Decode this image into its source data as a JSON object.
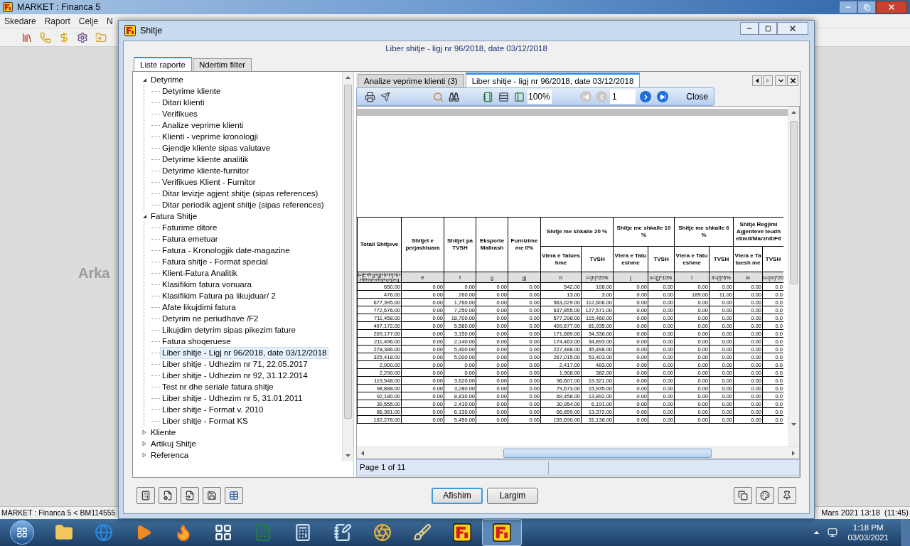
{
  "app_window": {
    "title": "MARKET : Financa 5",
    "menu": [
      "Skedare",
      "Raport",
      "Celje",
      "N"
    ],
    "background_text": "Arka",
    "status_left": "MARKET : Financa 5 < BM114555",
    "status_right": "Mars 2021 13:18  (11:45)"
  },
  "dialog": {
    "title": "Shitje",
    "subtitle": "Liber shitje - ligj nr 96/2018, date 03/12/2018",
    "tabs": [
      {
        "label": "Liste raporte",
        "selected": true
      },
      {
        "label": "Ndertim filter",
        "selected": false
      }
    ],
    "tree": [
      {
        "label": "Detyrime",
        "expanded": true,
        "selected": false,
        "children": [
          {
            "label": "Detyrime kliente",
            "selected": false
          },
          {
            "label": "Ditari klienti",
            "selected": false
          },
          {
            "label": "Verifikues",
            "selected": false
          },
          {
            "label": "Analize veprime klienti",
            "selected": false
          },
          {
            "label": "Klienti - veprime kronologji",
            "selected": false
          },
          {
            "label": "Gjendje kliente sipas valutave",
            "selected": false
          },
          {
            "label": "Detyrime kliente analitik",
            "selected": false
          },
          {
            "label": "Detyrime kliente-furnitor",
            "selected": false
          },
          {
            "label": "Verifikues Klient - Furnitor",
            "selected": false
          },
          {
            "label": "Ditar levizje agjent shitje (sipas references)",
            "selected": false
          },
          {
            "label": "Ditar periodik agjent shitje (sipas references)",
            "selected": false
          }
        ]
      },
      {
        "label": "Fatura Shitje",
        "expanded": true,
        "selected": false,
        "children": [
          {
            "label": "Faturime ditore",
            "selected": false
          },
          {
            "label": "Fatura emetuar",
            "selected": false
          },
          {
            "label": "Fatura - Kronologjik date-magazine",
            "selected": false
          },
          {
            "label": "Fatura shitje - Format special",
            "selected": false
          },
          {
            "label": "Klient-Fatura Analitik",
            "selected": false
          },
          {
            "label": "Klasifikim fatura vonuara",
            "selected": false
          },
          {
            "label": "Klasifikim Fatura pa likujduar/ 2",
            "selected": false
          },
          {
            "label": "Afate likujdimi fatura",
            "selected": false
          },
          {
            "label": "Detyrim ne periudhave /F2",
            "selected": false
          },
          {
            "label": "Likujdim detyrim sipas pikezim fature",
            "selected": false
          },
          {
            "label": "Fatura shoqeruese",
            "selected": false
          },
          {
            "label": "Liber shitje - Ligj nr 96/2018, date 03/12/2018",
            "selected": true
          },
          {
            "label": "Liber shitje - Udhezim nr 71, 22.05.2017",
            "selected": false
          },
          {
            "label": "Liber shitje - Udhezim nr 92, 31.12.2014",
            "selected": false
          },
          {
            "label": "Test nr dhe seriale fatura shitje",
            "selected": false
          },
          {
            "label": "Liber shitje - Udhezim nr 5, 31.01.2011",
            "selected": false
          },
          {
            "label": "Liber shitje - Format v. 2010",
            "selected": false
          },
          {
            "label": "Liber shitje - Format KS",
            "selected": false
          }
        ]
      },
      {
        "label": "Kliente",
        "expanded": false,
        "selected": false
      },
      {
        "label": "Artikuj Shitje",
        "expanded": false,
        "selected": false
      },
      {
        "label": "Referenca",
        "expanded": false,
        "selected": false
      }
    ],
    "report": {
      "tabs": [
        {
          "label": "Analize veprime klienti (3)",
          "selected": false
        },
        {
          "label": "Liber shitje - ligj nr 96/2018, date 03/12/2018",
          "selected": true
        }
      ],
      "zoom": "100%",
      "page": "1",
      "close": "Close",
      "nav": [
        {
          "kind": "first",
          "disabled": true
        },
        {
          "kind": "prev",
          "disabled": true
        },
        {
          "kind": "next",
          "disabled": false
        },
        {
          "kind": "last",
          "disabled": false
        }
      ],
      "status": "Page 1 of 11",
      "table": {
        "columns": [
          {
            "label": "Totali Shitjeve",
            "code": "t=(ë+f+g+gj+h+i+j+k+ l+ll+m+n+nj+o+p+q"
          },
          {
            "label": "Shitjet e perjashtuara",
            "code": "ë"
          },
          {
            "label": "Shitjet pa TVSH",
            "code": "f"
          },
          {
            "label": "Eksporte Mallrash",
            "code": "g"
          },
          {
            "label": "Furnizime me 0%",
            "code": "gj"
          }
        ],
        "groups": [
          {
            "label": "Shitje me shkalle 20 %",
            "columns": [
              {
                "label": "Vlera e Tatueshme",
                "code": "h"
              },
              {
                "label": "TVSH",
                "code": "i=(h)*20%"
              }
            ]
          },
          {
            "label": "Shitje me shkalle 10 %",
            "columns": [
              {
                "label": "Vlera e Tatueshme",
                "code": "j"
              },
              {
                "label": "TVSH",
                "code": "k=(j)*10%"
              }
            ]
          },
          {
            "label": "Shitje me shkalle 6 %",
            "columns": [
              {
                "label": "Vlera e Tatueshme",
                "code": "l"
              },
              {
                "label": "TVSH",
                "code": "ll=(l)*6%"
              }
            ]
          },
          {
            "label": "Shitje Regjimi Agjenteve teudh etimit/Marzhit/Fit",
            "columns": [
              {
                "label": "Vlera e Tatuesh me",
                "code": "m"
              },
              {
                "label": "TVSH",
                "code": "n=(m)*20"
              }
            ]
          }
        ],
        "rows": [
          [
            "650.00",
            "0.00",
            "0.00",
            "0.00",
            "0.00",
            "542.00",
            "108.00",
            "0.00",
            "0.00",
            "0.00",
            "0.00",
            "0.00",
            "0.0"
          ],
          [
            "476.00",
            "0.00",
            "260.00",
            "0.00",
            "0.00",
            "13.00",
            "3.00",
            "0.00",
            "0.00",
            "189.00",
            "11.00",
            "0.00",
            "0.0"
          ],
          [
            "677,395.00",
            "0.00",
            "1,760.00",
            "0.00",
            "0.00",
            "563,029.00",
            "112,606.00",
            "0.00",
            "0.00",
            "0.00",
            "0.00",
            "0.00",
            "0.0"
          ],
          [
            "772,676.00",
            "0.00",
            "7,250.00",
            "0.00",
            "0.00",
            "637,855.00",
            "127,571.00",
            "0.00",
            "0.00",
            "0.00",
            "0.00",
            "0.00",
            "0.0"
          ],
          [
            "711,458.00",
            "0.00",
            "18,700.00",
            "0.00",
            "0.00",
            "577,298.00",
            "115,460.00",
            "0.00",
            "0.00",
            "0.00",
            "0.00",
            "0.00",
            "0.0"
          ],
          [
            "497,172.00",
            "0.00",
            "5,560.00",
            "0.00",
            "0.00",
            "409,677.00",
            "81,935.00",
            "0.00",
            "0.00",
            "0.00",
            "0.00",
            "0.00",
            "0.0"
          ],
          [
            "209,177.00",
            "0.00",
            "3,150.00",
            "0.00",
            "0.00",
            "171,689.00",
            "34,338.00",
            "0.00",
            "0.00",
            "0.00",
            "0.00",
            "0.00",
            "0.0"
          ],
          [
            "211,496.00",
            "0.00",
            "2,140.00",
            "0.00",
            "0.00",
            "174,463.00",
            "34,893.00",
            "0.00",
            "0.00",
            "0.00",
            "0.00",
            "0.00",
            "0.0"
          ],
          [
            "278,386.00",
            "0.00",
            "5,400.00",
            "0.00",
            "0.00",
            "227,488.00",
            "45,498.00",
            "0.00",
            "0.00",
            "0.00",
            "0.00",
            "0.00",
            "0.0"
          ],
          [
            "325,418.00",
            "0.00",
            "5,000.00",
            "0.00",
            "0.00",
            "267,015.00",
            "53,403.00",
            "0.00",
            "0.00",
            "0.00",
            "0.00",
            "0.00",
            "0.0"
          ],
          [
            "2,900.00",
            "0.00",
            "0.00",
            "0.00",
            "0.00",
            "2,417.00",
            "483.00",
            "0.00",
            "0.00",
            "0.00",
            "0.00",
            "0.00",
            "0.0"
          ],
          [
            "2,290.00",
            "0.00",
            "0.00",
            "0.00",
            "0.00",
            "1,908.00",
            "382.00",
            "0.00",
            "0.00",
            "0.00",
            "0.00",
            "0.00",
            "0.0"
          ],
          [
            "119,548.00",
            "0.00",
            "3,620.00",
            "0.00",
            "0.00",
            "96,607.00",
            "19,321.00",
            "0.00",
            "0.00",
            "0.00",
            "0.00",
            "0.00",
            "0.0"
          ],
          [
            "98,888.00",
            "0.00",
            "3,280.00",
            "0.00",
            "0.00",
            "79,673.00",
            "15,935.00",
            "0.00",
            "0.00",
            "0.00",
            "0.00",
            "0.00",
            "0.0"
          ],
          [
            "92,180.00",
            "0.00",
            "8,830.00",
            "0.00",
            "0.00",
            "69,458.00",
            "13,892.00",
            "0.00",
            "0.00",
            "0.00",
            "0.00",
            "0.00",
            "0.0"
          ],
          [
            "39,555.00",
            "0.00",
            "2,410.00",
            "0.00",
            "0.00",
            "30,954.00",
            "6,191.00",
            "0.00",
            "0.00",
            "0.00",
            "0.00",
            "0.00",
            "0.0"
          ],
          [
            "86,361.00",
            "0.00",
            "6,130.00",
            "0.00",
            "0.00",
            "66,859.00",
            "13,372.00",
            "0.00",
            "0.00",
            "0.00",
            "0.00",
            "0.00",
            "0.0"
          ],
          [
            "192,278.00",
            "0.00",
            "5,450.00",
            "0.00",
            "0.00",
            "155,690.00",
            "31,138.00",
            "0.00",
            "0.00",
            "0.00",
            "0.00",
            "0.00",
            "0.0"
          ]
        ]
      }
    },
    "buttons": [
      {
        "label": "Afishim",
        "focused": true
      },
      {
        "label": "Largim",
        "focused": false
      }
    ]
  },
  "taskbar": {
    "time": "1:18 PM",
    "date": "03/03/2021"
  }
}
